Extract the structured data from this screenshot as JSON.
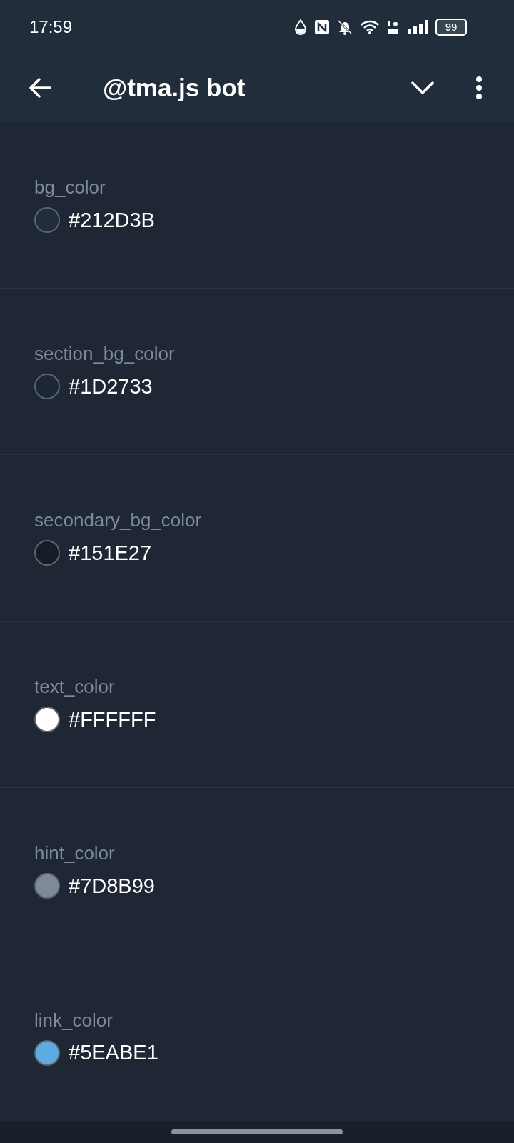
{
  "status_bar": {
    "time": "17:59",
    "battery": "99"
  },
  "header": {
    "title": "@tma.js bot"
  },
  "colors": [
    {
      "name": "bg_color",
      "value": "#212D3B",
      "color": "#212d3b"
    },
    {
      "name": "section_bg_color",
      "value": "#1D2733",
      "color": "#1d2733"
    },
    {
      "name": "secondary_bg_color",
      "value": "#151E27",
      "color": "#151e27"
    },
    {
      "name": "text_color",
      "value": "#FFFFFF",
      "color": "#ffffff"
    },
    {
      "name": "hint_color",
      "value": "#7D8B99",
      "color": "#7d8b99"
    },
    {
      "name": "link_color",
      "value": "#5EABE1",
      "color": "#5eabe1"
    }
  ]
}
